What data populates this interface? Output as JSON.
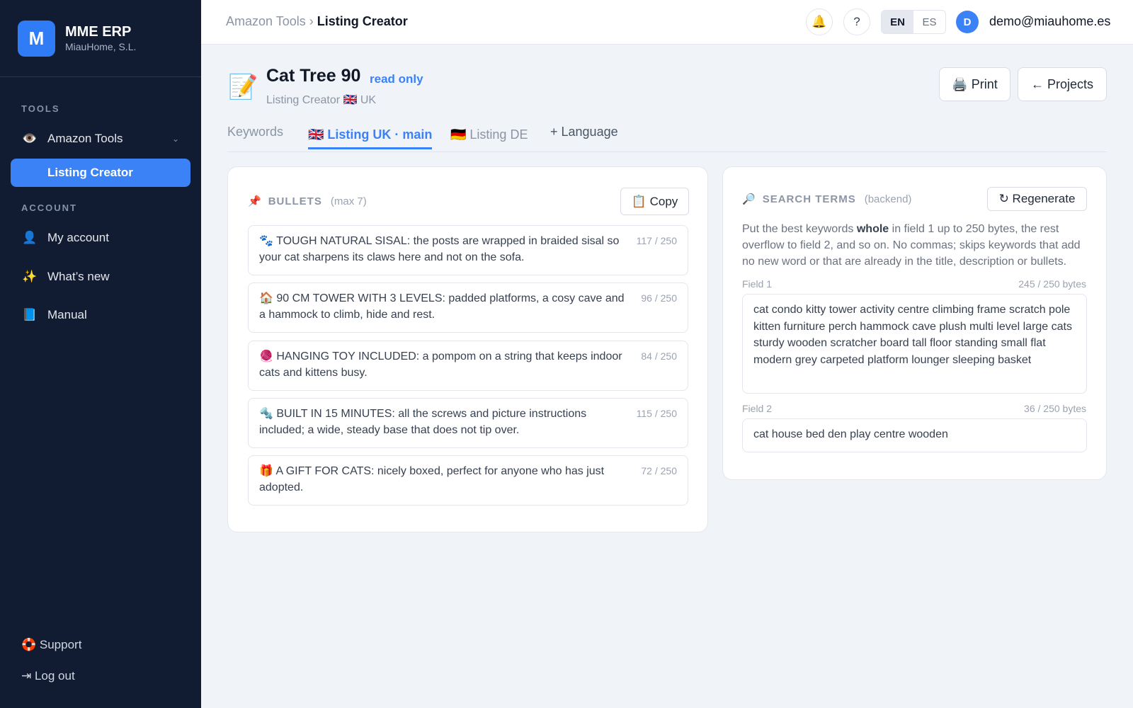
{
  "sidebar": {
    "logo_letter": "M",
    "app_name": "MME ERP",
    "company": "MiauHome, S.L.",
    "tools_label": "TOOLS",
    "amazon_tools": {
      "icon": "👁️",
      "label": "Amazon Tools",
      "chevron": "⌄"
    },
    "listing_creator": "Listing Creator",
    "account_label": "ACCOUNT",
    "account_items": [
      {
        "icon": "👤",
        "label": "My account"
      },
      {
        "icon": "✨",
        "label": "What’s new"
      },
      {
        "icon": "📘",
        "label": "Manual"
      }
    ],
    "support": "🛟 Support",
    "logout": "⇥ Log out"
  },
  "topbar": {
    "breadcrumb_parent": "Amazon Tools",
    "breadcrumb_sep": " › ",
    "breadcrumb_current": "Listing Creator",
    "bell_icon": "🔔",
    "help_icon": "?",
    "lang_en": "EN",
    "lang_es": "ES",
    "avatar_letter": "D",
    "email": "demo@miauhome.es"
  },
  "header": {
    "emoji": "📝",
    "title": "Cat Tree 90",
    "badge": "read only",
    "subtitle": "Listing Creator 🇬🇧 UK",
    "print_label": "🖨️ Print",
    "projects_label": "← Projects"
  },
  "tabs": {
    "keywords": "Keywords",
    "listing_uk": "🇬🇧 Listing UK · main",
    "listing_de": "🇩🇪 Listing DE",
    "add_language": "+ Language"
  },
  "bullets": {
    "icon": "📌",
    "title": "BULLETS",
    "hint": "(max 7)",
    "copy_label": "📋 Copy",
    "items": [
      {
        "text": "🐾 TOUGH NATURAL SISAL: the posts are wrapped in braided sisal so your cat sharpens its claws here and not on the sofa.",
        "count": "117 / 250"
      },
      {
        "text": "🏠 90 CM TOWER WITH 3 LEVELS: padded platforms, a cosy cave and a hammock to climb, hide and rest.",
        "count": "96 / 250"
      },
      {
        "text": "🧶 HANGING TOY INCLUDED: a pompom on a string that keeps indoor cats and kittens busy.",
        "count": "84 / 250"
      },
      {
        "text": "🔩 BUILT IN 15 MINUTES: all the screws and picture instructions included; a wide, steady base that does not tip over.",
        "count": "115 / 250"
      },
      {
        "text": "🎁 A GIFT FOR CATS: nicely boxed, perfect for anyone who has just adopted.",
        "count": "72 / 250"
      }
    ]
  },
  "search_terms": {
    "icon": "🔎",
    "title": "SEARCH TERMS",
    "hint": "(backend)",
    "regenerate_label": "↻ Regenerate",
    "desc_before": "Put the best keywords ",
    "desc_bold": "whole",
    "desc_after": " in field 1 up to 250 bytes, the rest overflow to field 2, and so on. No commas; skips keywords that add no new word or that are already in the title, description or bullets.",
    "field1_label": "Field 1",
    "field1_count": "245 / 250 bytes",
    "field1_value": "cat condo kitty tower activity centre climbing frame scratch pole kitten furniture perch hammock cave plush multi level large cats sturdy wooden scratcher board tall floor standing small flat modern grey carpeted platform lounger sleeping basket",
    "field2_label": "Field 2",
    "field2_count": "36 / 250 bytes",
    "field2_value": "cat house bed den play centre wooden"
  }
}
